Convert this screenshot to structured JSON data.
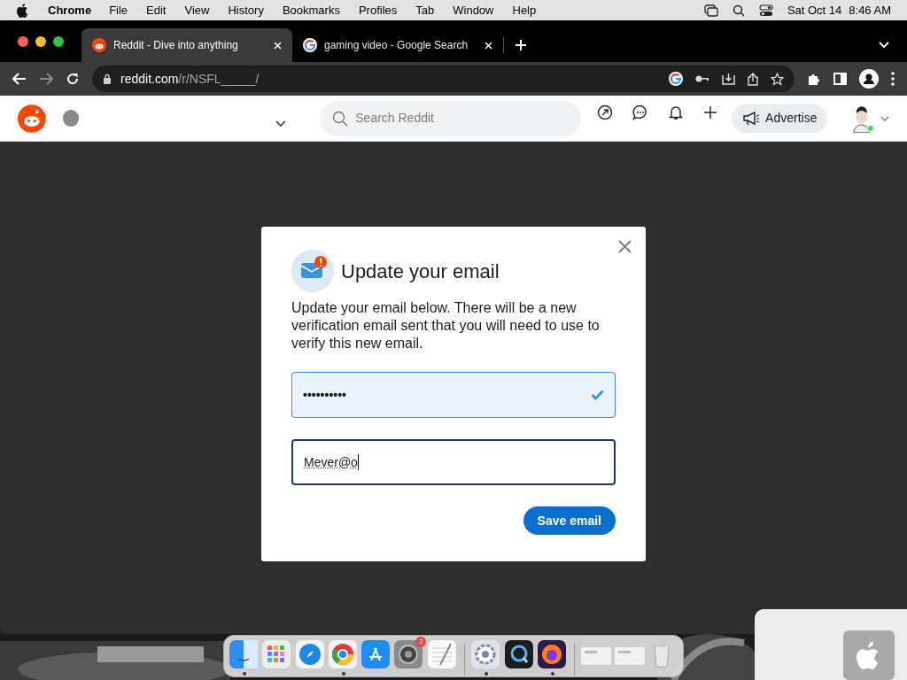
{
  "menubar": {
    "app": "Chrome",
    "menus": [
      "File",
      "Edit",
      "View",
      "History",
      "Bookmarks",
      "Profiles",
      "Tab",
      "Window",
      "Help"
    ],
    "date": "Sat Oct 14",
    "time": "8:46 AM"
  },
  "tabs": [
    {
      "kind": "reddit",
      "title": "Reddit - Dive into anything",
      "selected": true
    },
    {
      "kind": "google",
      "title": "gaming video - Google Search",
      "selected": false
    }
  ],
  "address": {
    "host": "reddit.com",
    "path": "/r/NSFL_____/",
    "forward_disabled": true
  },
  "header": {
    "search_placeholder": "Search Reddit",
    "advertise": "Advertise"
  },
  "modal": {
    "title": "Update your email",
    "body": "Update your email below. There will be a new verification email sent that you will need to use to verify this new email.",
    "fields": [
      {
        "kind": "password",
        "value": "••••••••••",
        "valid": true,
        "focused": false
      },
      {
        "kind": "email",
        "value": "Mever@o",
        "valid": false,
        "focused": true
      }
    ],
    "button": "Save email"
  },
  "dock": [
    {
      "kind": "finder",
      "running": true
    },
    {
      "kind": "launchpad",
      "running": false
    },
    {
      "kind": "safari",
      "running": false
    },
    {
      "kind": "chrome",
      "running": true
    },
    {
      "kind": "appstore",
      "running": false
    },
    {
      "kind": "settings",
      "running": false,
      "badge": "2"
    },
    {
      "kind": "notes",
      "running": false
    },
    {
      "kind": "divider"
    },
    {
      "kind": "sysprefs",
      "running": true
    },
    {
      "kind": "quicktime",
      "running": false
    },
    {
      "kind": "firefox",
      "running": true
    },
    {
      "kind": "divider"
    },
    {
      "kind": "window",
      "running": false
    },
    {
      "kind": "window",
      "running": false
    },
    {
      "kind": "trash",
      "running": false
    }
  ]
}
